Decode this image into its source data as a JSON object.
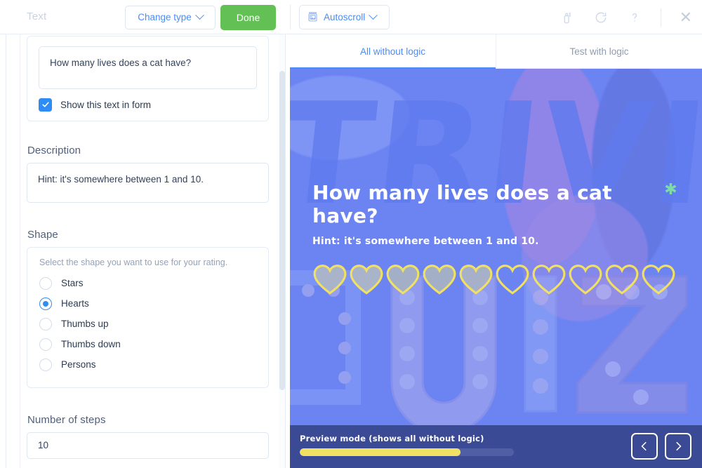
{
  "toolbar": {
    "type_label": "Text",
    "change_type_label": "Change type",
    "done_label": "Done",
    "autoscroll_label": "Autoscroll",
    "icons": {
      "change_type_chevron": "chevron-down-icon",
      "autoscroll": "slide-image-icon",
      "autoscroll_chevron": "chevron-down-icon",
      "device": "spray-device-icon",
      "refresh": "refresh-icon",
      "help": "question-mark-icon",
      "close": "close-icon"
    }
  },
  "form": {
    "question": {
      "value": "How many lives does a cat have?",
      "show_in_form_label": "Show this text in form",
      "show_in_form_checked": true,
      "checkbox_icon": "checkmark-icon"
    },
    "description": {
      "label": "Description",
      "value": "Hint: it's somewhere between 1 and 10."
    },
    "shape": {
      "label": "Shape",
      "hint": "Select the shape you want to use for your rating.",
      "selected": "Hearts",
      "options": [
        {
          "label": "Stars",
          "selected": false
        },
        {
          "label": "Hearts",
          "selected": true
        },
        {
          "label": "Thumbs up",
          "selected": false
        },
        {
          "label": "Thumbs down",
          "selected": false
        },
        {
          "label": "Persons",
          "selected": false
        }
      ]
    },
    "steps": {
      "label": "Number of steps",
      "value": "10"
    }
  },
  "preview": {
    "tabs": [
      {
        "label": "All without logic",
        "active": true
      },
      {
        "label": "Test with logic",
        "active": false
      }
    ],
    "background_word_top": "TRIVI",
    "background_word_bottom": "QUIZ",
    "question_title": "How many lives does a cat have?",
    "required_marker": "✱",
    "question_hint": "Hint: it's somewhere between 1 and 10.",
    "rating": {
      "shape": "heart",
      "total": 10,
      "filled": 5
    },
    "footer": {
      "mode_label": "Preview mode (shows all without logic)",
      "progress_percent": 75,
      "prev_icon": "chevron-left-icon",
      "next_icon": "chevron-right-icon"
    }
  },
  "colors": {
    "accent_blue": "#4a8cf7",
    "done_green": "#62c054",
    "stage_blue": "#6b84f2",
    "footer_blue": "#3b4a95",
    "progress_yellow": "#f0e063",
    "heart_outline": "#f0e063",
    "required_green": "#7ddba8"
  }
}
